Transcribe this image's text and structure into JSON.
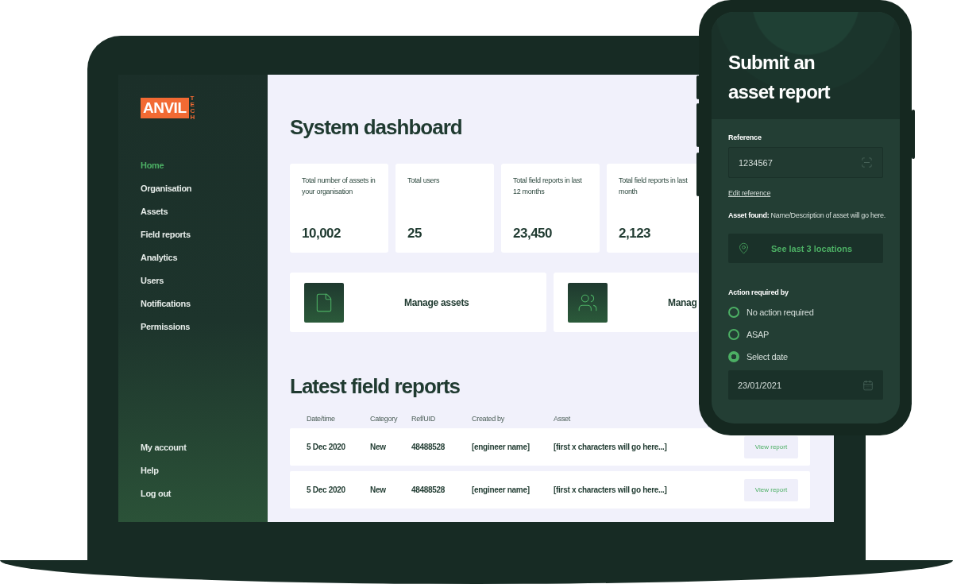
{
  "laptop": {
    "logo": {
      "text": "ANVIL",
      "sub": "TECH"
    },
    "sidebar": {
      "items": [
        {
          "label": "Home",
          "selected": true
        },
        {
          "label": "Organisation",
          "selected": false
        },
        {
          "label": "Assets",
          "selected": false
        },
        {
          "label": "Field reports",
          "selected": false
        },
        {
          "label": "Analytics",
          "selected": false
        },
        {
          "label": "Users",
          "selected": false
        },
        {
          "label": "Notifications",
          "selected": false
        },
        {
          "label": "Permissions",
          "selected": false
        }
      ],
      "footer_items": [
        {
          "label": "My account",
          "selected": false
        },
        {
          "label": "Help",
          "selected": false
        },
        {
          "label": "Log out",
          "selected": false
        }
      ]
    },
    "main": {
      "title": "System dashboard",
      "stats": [
        {
          "label": "Total number of assets in your organisation",
          "value": "10,002"
        },
        {
          "label": "Total users",
          "value": "25"
        },
        {
          "label": "Total field reports in last 12 months",
          "value": "23,450"
        },
        {
          "label": "Total field reports in last month",
          "value": "2,123"
        }
      ],
      "actions": [
        {
          "label": "Manage assets",
          "kind": "file"
        },
        {
          "label": "Manag",
          "kind": "users"
        }
      ],
      "reports": {
        "title": "Latest field reports",
        "columns": [
          "Date/time",
          "Category",
          "Ref/UID",
          "Created by",
          "Asset"
        ],
        "rows": [
          {
            "date": "5 Dec 2020",
            "category": "New",
            "ref": "48488528",
            "created_by": "[engineer name]",
            "asset": "[first x characters will go here...]",
            "action": "View report"
          },
          {
            "date": "5 Dec 2020",
            "category": "New",
            "ref": "48488528",
            "created_by": "[engineer name]",
            "asset": "[first x characters will go here...]",
            "action": "View report"
          }
        ]
      }
    }
  },
  "phone": {
    "title_lines": [
      "Submit an",
      "asset report"
    ],
    "reference": {
      "label": "Reference",
      "value": "1234567"
    },
    "edit_link": "Edit reference",
    "asset_found": "**Asset found:** Name/Description of asset will go here.",
    "locations_button": "See last 3 locations",
    "action_label": "Action required by",
    "options": [
      {
        "label": "No action required",
        "selected": false
      },
      {
        "label": "ASAP",
        "selected": false
      },
      {
        "label": "Select date",
        "selected": true
      }
    ],
    "date": {
      "value": "23/01/2021"
    }
  }
}
